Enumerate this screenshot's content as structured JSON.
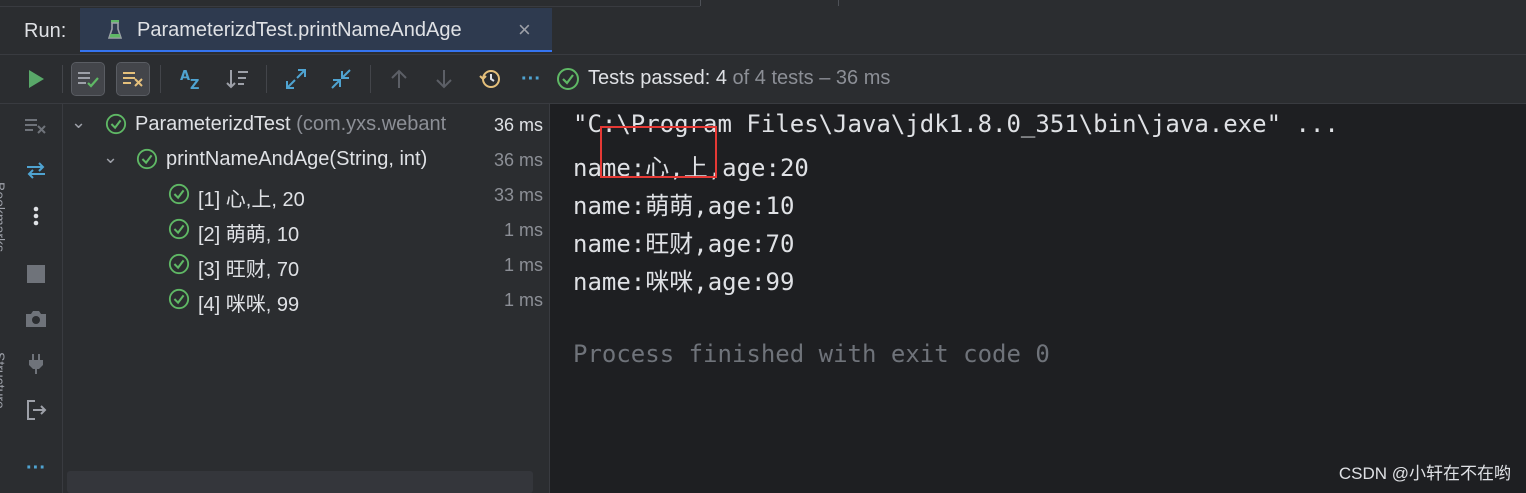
{
  "run_panel": {
    "label": "Run:",
    "tab": {
      "title": "ParameterizdTest.printNameAndAge",
      "close": "×",
      "icon": "test-flask-icon"
    }
  },
  "toolbar": {
    "status_passed": "Tests passed: 4",
    "status_rest": " of 4 tests – 36 ms",
    "more": "···"
  },
  "colors": {
    "pass_green": "#5fb865",
    "run_green": "#59a869",
    "accent_blue": "#3574f0",
    "highlight_red": "#e53935"
  },
  "gutter": {
    "bookmarks": "Bookmarks",
    "structure": "Structure"
  },
  "tree": {
    "root": {
      "name": "ParameterizdTest",
      "package": " (com.yxs.webant",
      "time": "36 ms"
    },
    "method": {
      "name": "printNameAndAge(String, int)",
      "time": "36 ms"
    },
    "cases": [
      {
        "label": "[1] 心,上, 20",
        "time": "33 ms"
      },
      {
        "label": "[2] 萌萌, 10",
        "time": "1 ms"
      },
      {
        "label": "[3] 旺财, 70",
        "time": "1 ms"
      },
      {
        "label": "[4] 咪咪, 99",
        "time": "1 ms"
      }
    ]
  },
  "console": {
    "lines": [
      "\"C:\\Program Files\\Java\\jdk1.8.0_351\\bin\\java.exe\" ...",
      "name:心,上,age:20",
      "name:萌萌,age:10",
      "name:旺财,age:70",
      "name:咪咪,age:99"
    ],
    "finish": "Process finished with exit code 0"
  },
  "watermark": "CSDN @小轩在不在哟"
}
